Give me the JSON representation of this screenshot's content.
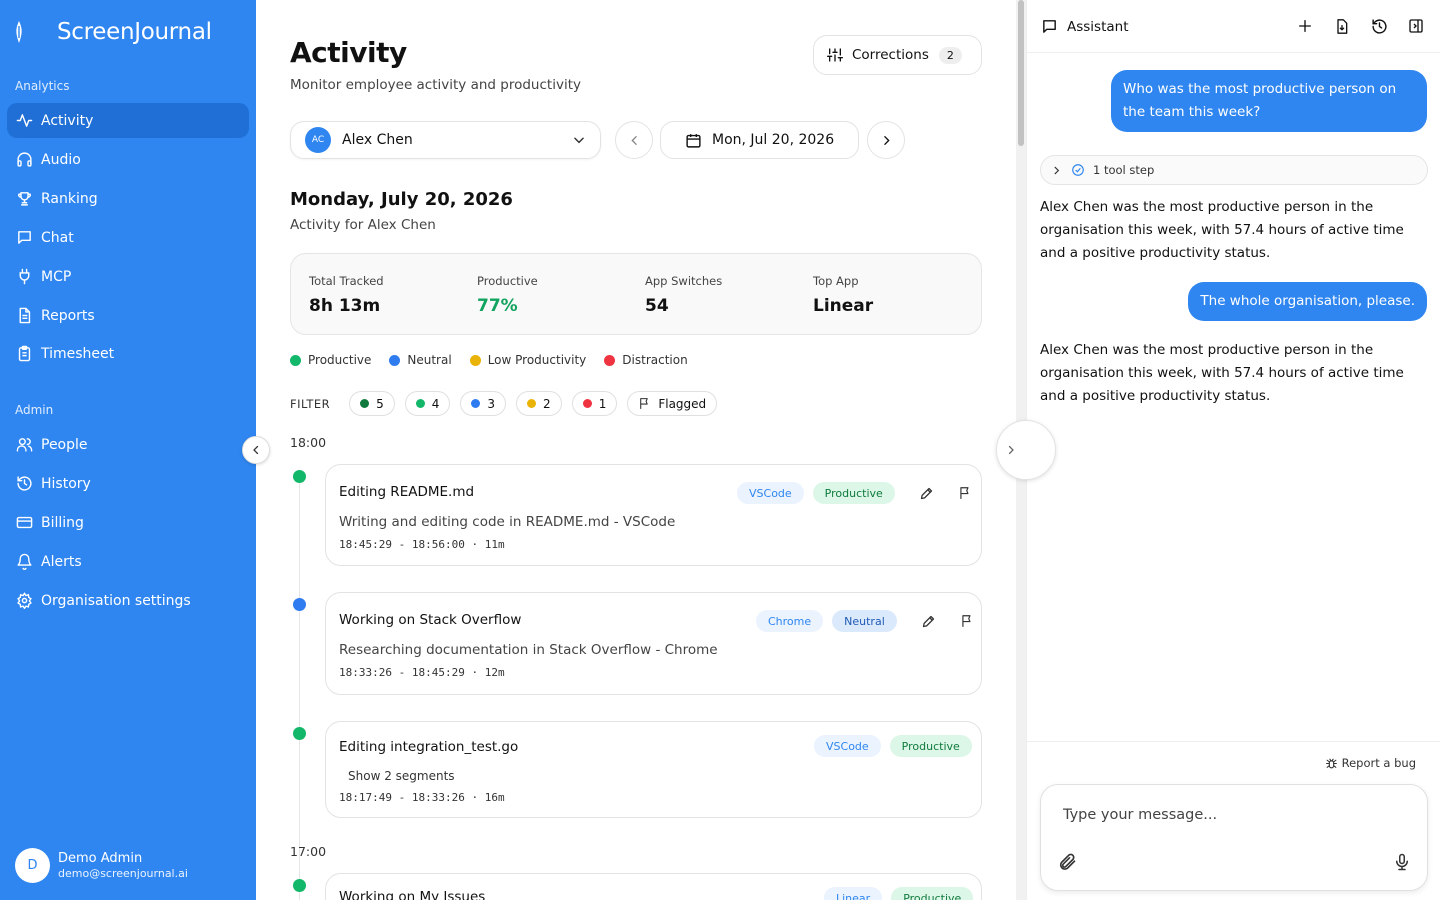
{
  "brand": {
    "name": "ScreenJournal"
  },
  "sidebar": {
    "analytics_label": "Analytics",
    "admin_label": "Admin",
    "analytics_items": [
      {
        "label": "Activity",
        "icon": "activity-icon",
        "active": true
      },
      {
        "label": "Audio",
        "icon": "headphones-icon"
      },
      {
        "label": "Ranking",
        "icon": "trophy-icon"
      },
      {
        "label": "Chat",
        "icon": "chat-icon"
      },
      {
        "label": "MCP",
        "icon": "plug-icon"
      },
      {
        "label": "Reports",
        "icon": "document-icon"
      },
      {
        "label": "Timesheet",
        "icon": "clipboard-icon"
      }
    ],
    "admin_items": [
      {
        "label": "People",
        "icon": "people-icon"
      },
      {
        "label": "History",
        "icon": "history-icon"
      },
      {
        "label": "Billing",
        "icon": "credit-card-icon"
      },
      {
        "label": "Alerts",
        "icon": "bell-icon"
      },
      {
        "label": "Organisation settings",
        "icon": "gear-icon"
      }
    ],
    "user": {
      "initial": "D",
      "name": "Demo Admin",
      "email": "demo@screenjournal.ai"
    }
  },
  "header": {
    "title": "Activity",
    "subtitle": "Monitor employee activity and productivity",
    "corrections_label": "Corrections",
    "corrections_count": "2"
  },
  "controls": {
    "person_initials": "AC",
    "person_name": "Alex Chen",
    "date_label": "Mon, Jul 20, 2026"
  },
  "day": {
    "title": "Monday, July 20, 2026",
    "subtitle": "Activity for Alex Chen"
  },
  "stats": [
    {
      "label": "Total Tracked",
      "value": "8h 13m"
    },
    {
      "label": "Productive",
      "value": "77%"
    },
    {
      "label": "App Switches",
      "value": "54"
    },
    {
      "label": "Top App",
      "value": "Linear"
    }
  ],
  "legend": [
    {
      "label": "Productive",
      "color": "#12b76a"
    },
    {
      "label": "Neutral",
      "color": "#2f7cf0"
    },
    {
      "label": "Low Productivity",
      "color": "#eab308"
    },
    {
      "label": "Distraction",
      "color": "#ef3340"
    }
  ],
  "filter": {
    "label": "FILTER",
    "chips": [
      {
        "count": "5",
        "color": "#0f7a3c"
      },
      {
        "count": "4",
        "color": "#12b76a"
      },
      {
        "count": "3",
        "color": "#2f7cf0"
      },
      {
        "count": "2",
        "color": "#eab308"
      },
      {
        "count": "1",
        "color": "#ef3340"
      }
    ],
    "flagged_label": "Flagged"
  },
  "timeline": {
    "hour_1": "18:00",
    "hour_2": "17:00",
    "entries": [
      {
        "title": "Editing README.md",
        "app": "VSCode",
        "status": "Productive",
        "description": "Writing and editing code in README.md - VSCode",
        "time": "18:45:29 - 18:56:00 · 11m"
      },
      {
        "title": "Working on Stack Overflow",
        "app": "Chrome",
        "status": "Neutral",
        "description": "Researching documentation in Stack Overflow - Chrome",
        "time": "18:33:26 - 18:45:29 · 12m"
      },
      {
        "title": "Editing integration_test.go",
        "app": "VSCode",
        "status": "Productive",
        "segments_link": "Show 2 segments",
        "time": "18:17:49 - 18:33:26 · 16m"
      },
      {
        "title": "Working on My Issues",
        "app": "Linear",
        "status": "Productive"
      }
    ]
  },
  "assistant": {
    "title": "Assistant",
    "messages": [
      {
        "role": "user",
        "text": "Who was the most productive person on the team this week?"
      },
      {
        "role": "tool",
        "text": "1 tool step"
      },
      {
        "role": "assistant",
        "text": "Alex Chen was the most productive person in the organisation this week, with 57.4 hours of active time and a positive productivity status."
      },
      {
        "role": "user",
        "text": "The whole organisation, please."
      },
      {
        "role": "assistant",
        "text": "Alex Chen was the most productive person in the organisation this week, with 57.4 hours of active time and a positive productivity status."
      }
    ],
    "report_bug_label": "Report a bug",
    "input_placeholder": "Type your message..."
  },
  "colors": {
    "sidebar": "#2f86f0",
    "sidebar_active": "#1f6fd6",
    "productive_text": "#12a35f"
  }
}
